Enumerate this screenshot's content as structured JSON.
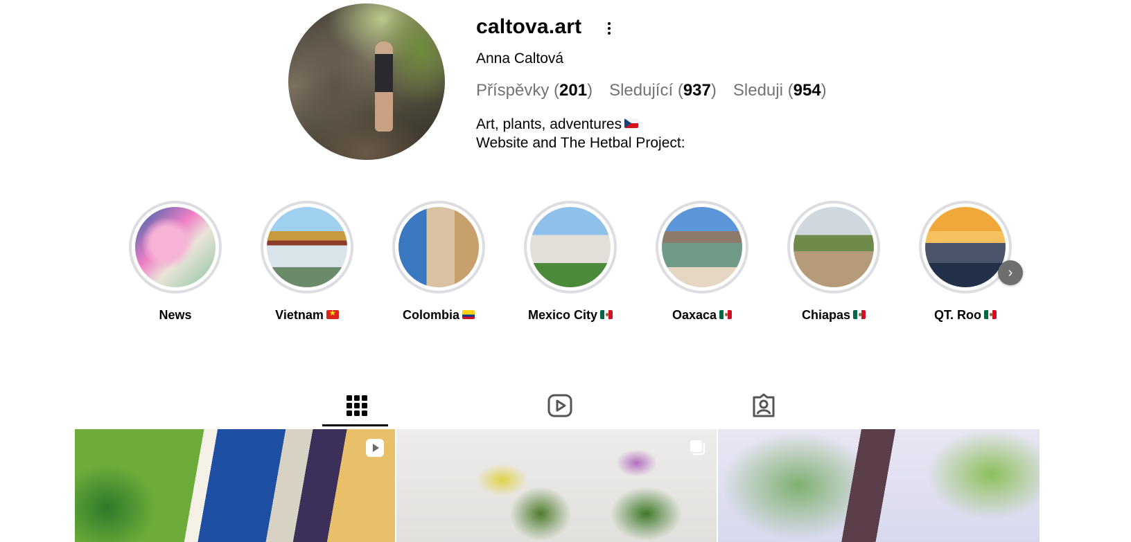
{
  "profile": {
    "username": "caltova.art",
    "full_name": "Anna Caltová",
    "stats": {
      "posts_label": "Příspěvky",
      "posts_count": "201",
      "followers_label": "Sledující",
      "followers_count": "937",
      "following_label": "Sleduji",
      "following_count": "954"
    },
    "bio_line1": "Art, plants, adventures",
    "bio_line2": "Website and The Hetbal Project:"
  },
  "highlights": [
    {
      "label": "News",
      "flag": ""
    },
    {
      "label": "Vietnam",
      "flag": "vn"
    },
    {
      "label": "Colombia",
      "flag": "co"
    },
    {
      "label": "Mexico City",
      "flag": "mx"
    },
    {
      "label": "Oaxaca",
      "flag": "mx"
    },
    {
      "label": "Chiapas",
      "flag": "mx"
    },
    {
      "label": "QT. Roo",
      "flag": "mx"
    }
  ],
  "tabs": [
    {
      "icon": "grid-icon",
      "active": true
    },
    {
      "icon": "reels-icon",
      "active": false
    },
    {
      "icon": "tagged-icon",
      "active": false
    }
  ],
  "posts": [
    {
      "type": "reel",
      "icon": "reel-badge-icon"
    },
    {
      "type": "carousel",
      "icon": "carousel-badge-icon"
    },
    {
      "type": "image",
      "icon": ""
    }
  ]
}
